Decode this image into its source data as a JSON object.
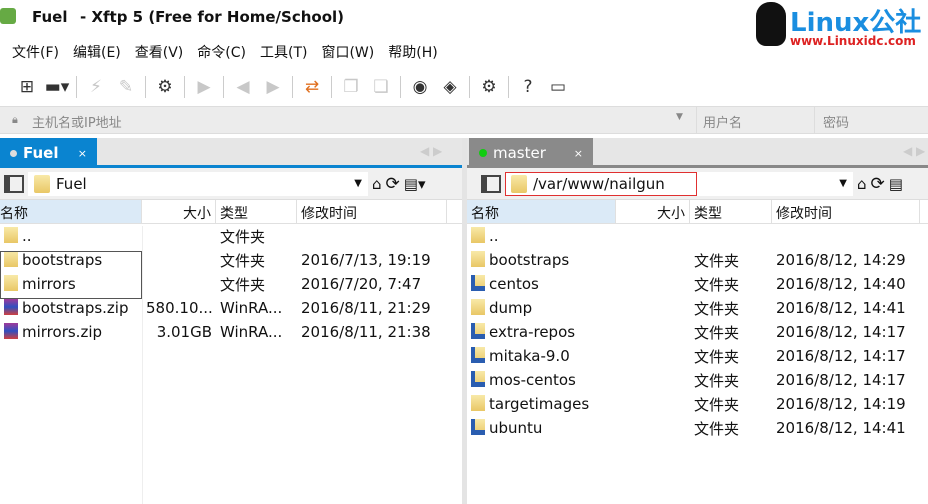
{
  "title": {
    "session": "Fuel",
    "app": "- Xftp 5 (Free for Home/School)",
    "watermark": "Linux公社",
    "watermark_url": "www.Linuxidc.com"
  },
  "menu": [
    "文件(F)",
    "编辑(E)",
    "查看(V)",
    "命令(C)",
    "工具(T)",
    "窗口(W)",
    "帮助(H)"
  ],
  "address": {
    "host_placeholder": "主机名或IP地址",
    "user_placeholder": "用户名",
    "password_placeholder": "密码"
  },
  "columns": {
    "name": "名称",
    "size": "大小",
    "type": "类型",
    "modified": "修改时间"
  },
  "left": {
    "tab": "Fuel",
    "path": "Fuel",
    "files": [
      {
        "name": "..",
        "size": "",
        "type": "文件夹",
        "modified": "",
        "icon": "folder"
      },
      {
        "name": "bootstraps",
        "size": "",
        "type": "文件夹",
        "modified": "2016/7/13, 19:19",
        "icon": "folder"
      },
      {
        "name": "mirrors",
        "size": "",
        "type": "文件夹",
        "modified": "2016/7/20, 7:47",
        "icon": "folder"
      },
      {
        "name": "bootstraps.zip",
        "size": "580.10...",
        "type": "WinRA...",
        "modified": "2016/8/11, 21:29",
        "icon": "archive"
      },
      {
        "name": "mirrors.zip",
        "size": "3.01GB",
        "type": "WinRA...",
        "modified": "2016/8/11, 21:38",
        "icon": "archive"
      }
    ]
  },
  "right": {
    "tab": "master",
    "path": "/var/www/nailgun",
    "files": [
      {
        "name": "..",
        "size": "",
        "type": "",
        "modified": "",
        "icon": "folder"
      },
      {
        "name": "bootstraps",
        "size": "",
        "type": "文件夹",
        "modified": "2016/8/12, 14:29",
        "icon": "folder"
      },
      {
        "name": "centos",
        "size": "",
        "type": "文件夹",
        "modified": "2016/8/12, 14:40",
        "icon": "link"
      },
      {
        "name": "dump",
        "size": "",
        "type": "文件夹",
        "modified": "2016/8/12, 14:41",
        "icon": "folder"
      },
      {
        "name": "extra-repos",
        "size": "",
        "type": "文件夹",
        "modified": "2016/8/12, 14:17",
        "icon": "link"
      },
      {
        "name": "mitaka-9.0",
        "size": "",
        "type": "文件夹",
        "modified": "2016/8/12, 14:17",
        "icon": "link"
      },
      {
        "name": "mos-centos",
        "size": "",
        "type": "文件夹",
        "modified": "2016/8/12, 14:17",
        "icon": "link"
      },
      {
        "name": "targetimages",
        "size": "",
        "type": "文件夹",
        "modified": "2016/8/12, 14:19",
        "icon": "folder"
      },
      {
        "name": "ubuntu",
        "size": "",
        "type": "文件夹",
        "modified": "2016/8/12, 14:41",
        "icon": "link"
      }
    ]
  }
}
